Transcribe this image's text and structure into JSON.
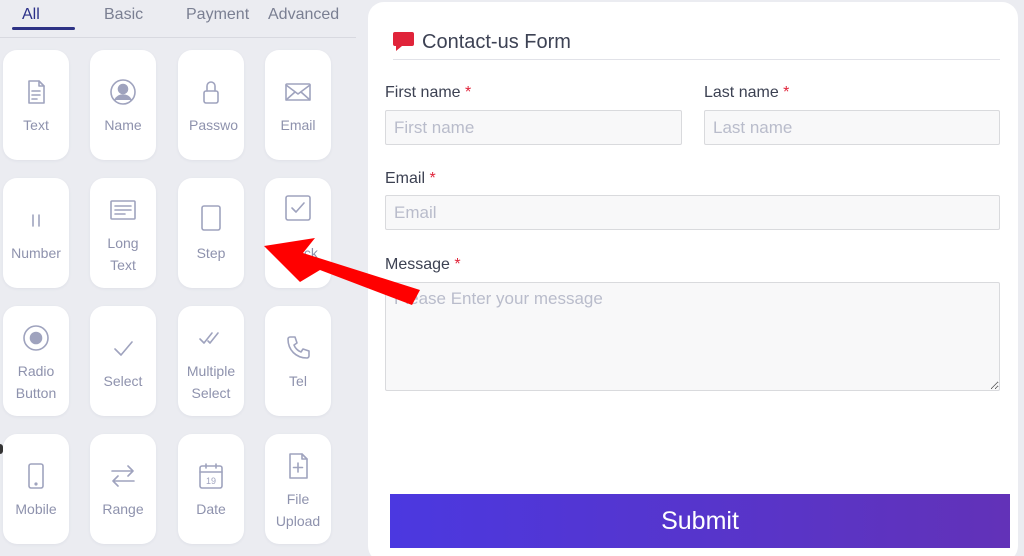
{
  "tabs": [
    "All",
    "Basic",
    "Payment",
    "Advanced"
  ],
  "tiles": [
    {
      "label": "Text",
      "icon": "text-file-icon"
    },
    {
      "label": "Name",
      "icon": "user-circle-icon"
    },
    {
      "label": "Passwo",
      "icon": "lock-icon"
    },
    {
      "label": "Email",
      "icon": "envelope-icon"
    },
    {
      "label": "Number",
      "icon": "number-bars-icon"
    },
    {
      "label": "Long\nText",
      "icon": "long-text-icon"
    },
    {
      "label": "Step",
      "icon": "step-rectangle-icon"
    },
    {
      "label": "Check",
      "icon": "checkbox-icon"
    },
    {
      "label": "Radio\nButton",
      "icon": "radio-icon"
    },
    {
      "label": "Select",
      "icon": "checkmark-icon"
    },
    {
      "label": "Multiple\nSelect",
      "icon": "double-check-icon"
    },
    {
      "label": "Tel",
      "icon": "phone-icon"
    },
    {
      "label": "Mobile",
      "icon": "mobile-icon"
    },
    {
      "label": "Range",
      "icon": "range-arrows-icon"
    },
    {
      "label": "Date",
      "icon": "calendar-icon",
      "date_number": "19"
    },
    {
      "label": "File\nUpload",
      "icon": "file-plus-icon"
    }
  ],
  "form": {
    "title": "Contact-us Form",
    "first_name": {
      "label": "First name",
      "required": "*",
      "placeholder": "First name"
    },
    "last_name": {
      "label": "Last name",
      "required": "*",
      "placeholder": "Last name"
    },
    "email": {
      "label": "Email",
      "required": "*",
      "placeholder": "Email"
    },
    "message": {
      "label": "Message",
      "required": "*",
      "placeholder": "Please Enter your message"
    },
    "submit_label": "Submit"
  },
  "colors": {
    "accent": "#2d3285",
    "submit_gradient_start": "#4b38e0",
    "submit_gradient_end": "#6232b8",
    "required": "#e0243a",
    "annotation_arrow": "#ff0000"
  }
}
